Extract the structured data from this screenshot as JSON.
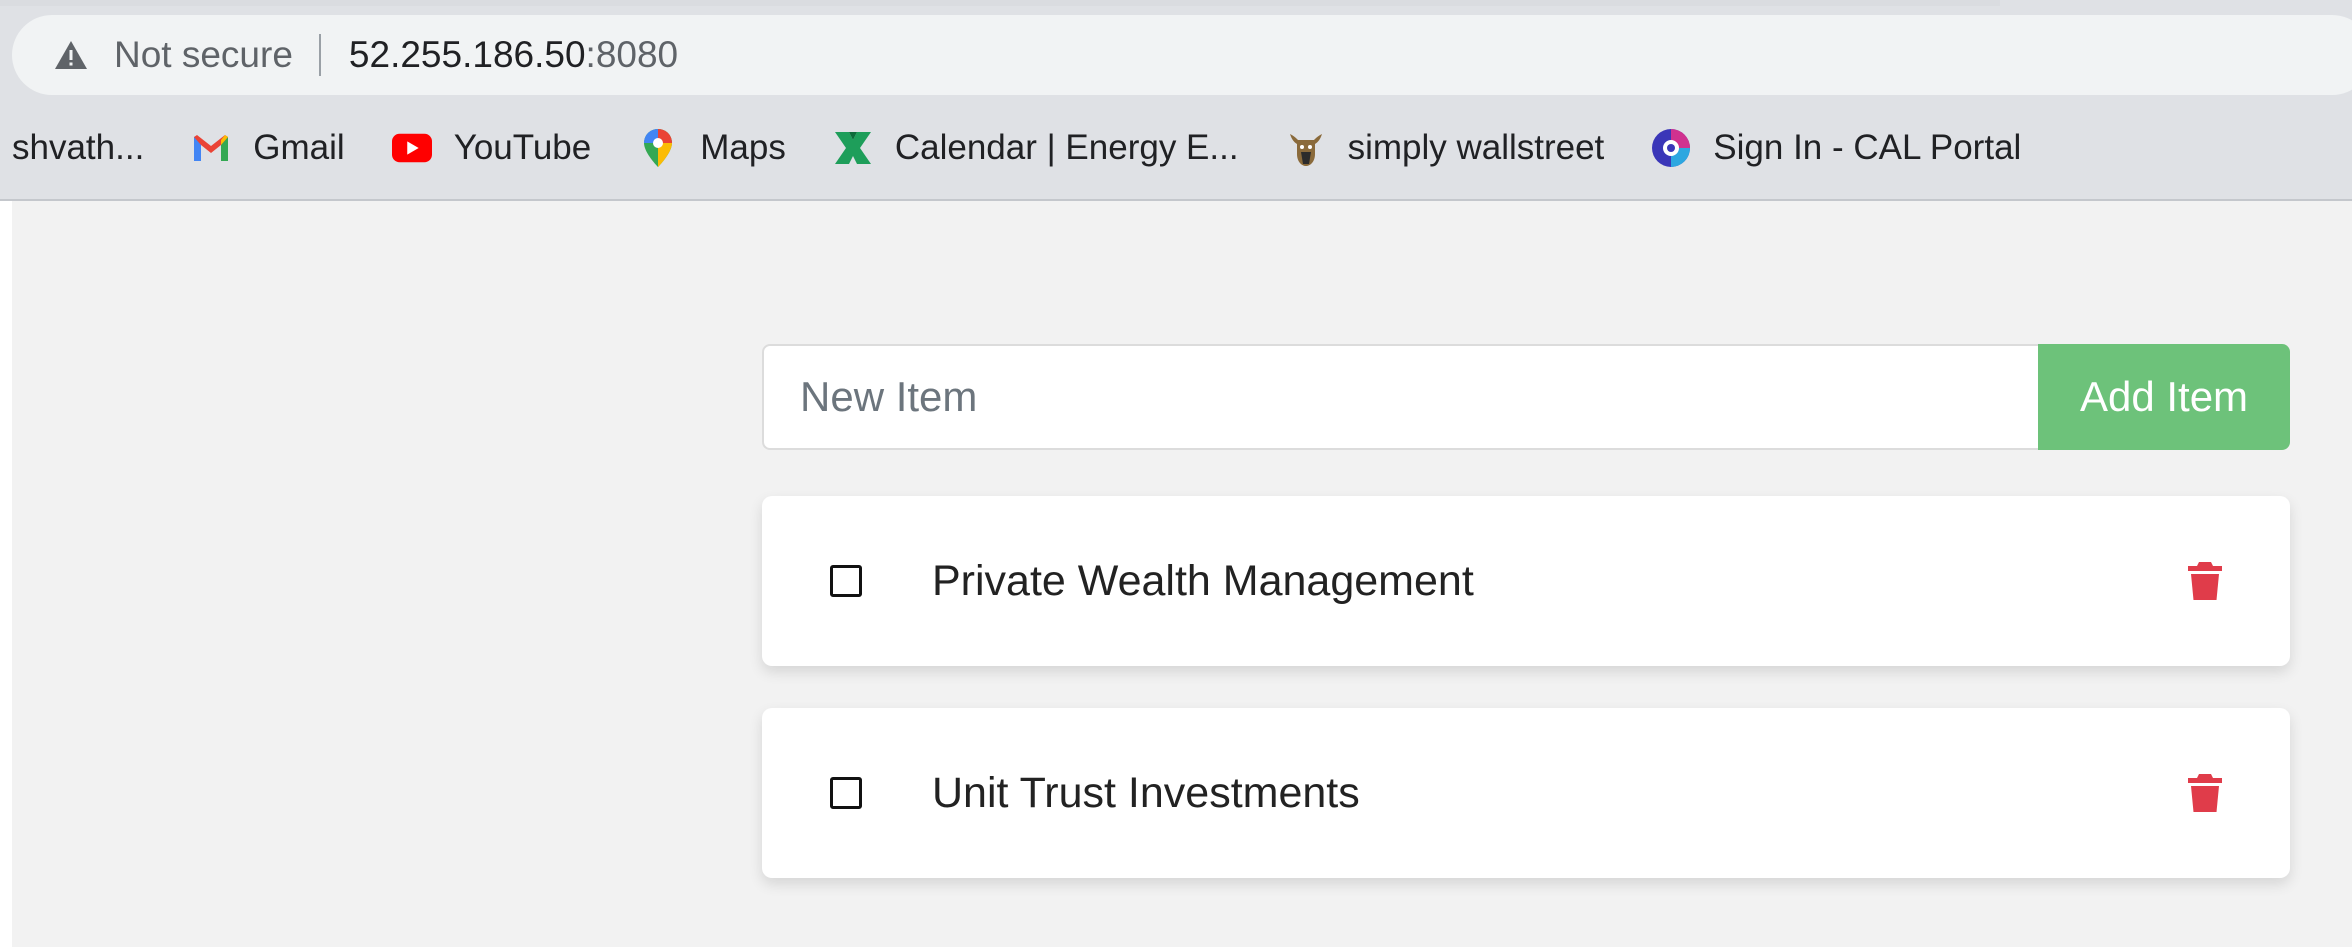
{
  "browser": {
    "security_label": "Not secure",
    "url_host": "52.255.186.50",
    "url_port": ":8080",
    "bookmarks": [
      {
        "label": "shvath...",
        "icon": ""
      },
      {
        "label": "Gmail",
        "icon": "gmail-icon"
      },
      {
        "label": "YouTube",
        "icon": "youtube-icon"
      },
      {
        "label": "Maps",
        "icon": "maps-icon"
      },
      {
        "label": "Calendar | Energy E...",
        "icon": "calendar-icon"
      },
      {
        "label": "simply wallstreet",
        "icon": "bull-icon"
      },
      {
        "label": "Sign In - CAL Portal",
        "icon": "portal-icon"
      }
    ]
  },
  "form": {
    "input_value": "",
    "input_placeholder": "New Item",
    "add_button_label": "Add Item"
  },
  "items": [
    {
      "label": "Private Wealth Management",
      "checked": false
    },
    {
      "label": "Unit Trust Investments",
      "checked": false
    }
  ],
  "colors": {
    "add_button": "#6dc27a",
    "delete_icon": "#e03c4a",
    "page_background": "#f2f2f2"
  }
}
